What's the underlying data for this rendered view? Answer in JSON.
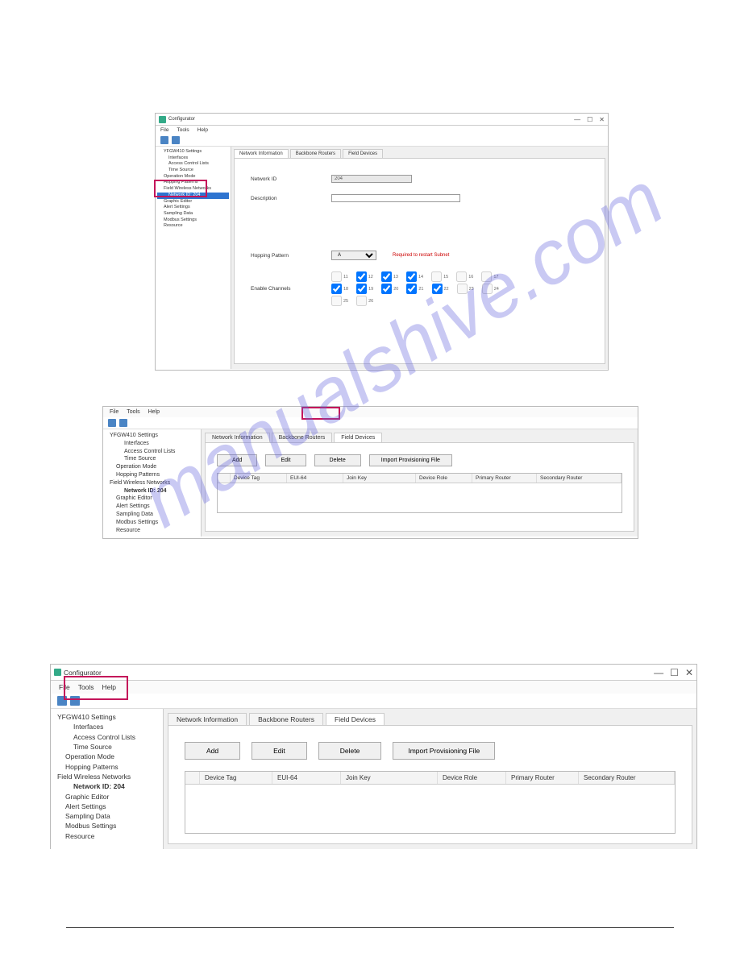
{
  "watermark": "manualshive.com",
  "app_title": "Configurator",
  "menu": {
    "file": "File",
    "tools": "Tools",
    "help": "Help"
  },
  "winctrl": {
    "min": "—",
    "max": "☐",
    "close": "✕"
  },
  "tree": {
    "root": "YFGW410 Settings",
    "interfaces": "Interfaces",
    "acl": "Access Control Lists",
    "time": "Time Source",
    "opmode": "Operation Mode",
    "hopping": "Hopping Patterns",
    "fwn": "Field Wireless Networks",
    "netid": "Network ID: 204",
    "graphic": "Graphic Editor",
    "alert": "Alert Settings",
    "sampling": "Sampling Data",
    "modbus": "Modbus Settings",
    "resource": "Resource"
  },
  "tabs": {
    "netinfo": "Network Information",
    "backbone": "Backbone Routers",
    "fielddev": "Field Devices"
  },
  "form": {
    "netid_label": "Network ID",
    "netid_value": "204",
    "desc_label": "Description",
    "desc_value": "",
    "hopping_label": "Hopping Pattern",
    "hopping_value": "A",
    "hopping_note": "Required to restart Subnet",
    "channels_label": "Enable Channels",
    "channels": [
      "11",
      "12",
      "13",
      "14",
      "15",
      "16",
      "17",
      "18",
      "19",
      "20",
      "21",
      "22",
      "23",
      "24",
      "25",
      "26"
    ]
  },
  "buttons": {
    "add": "Add",
    "edit": "Edit",
    "delete": "Delete",
    "import": "Import Provisioning File"
  },
  "grid_headers": {
    "tag": "Device Tag",
    "eui": "EUI-64",
    "joinkey": "Join Key",
    "role": "Device Role",
    "primary": "Primary Router",
    "secondary": "Secondary Router"
  }
}
